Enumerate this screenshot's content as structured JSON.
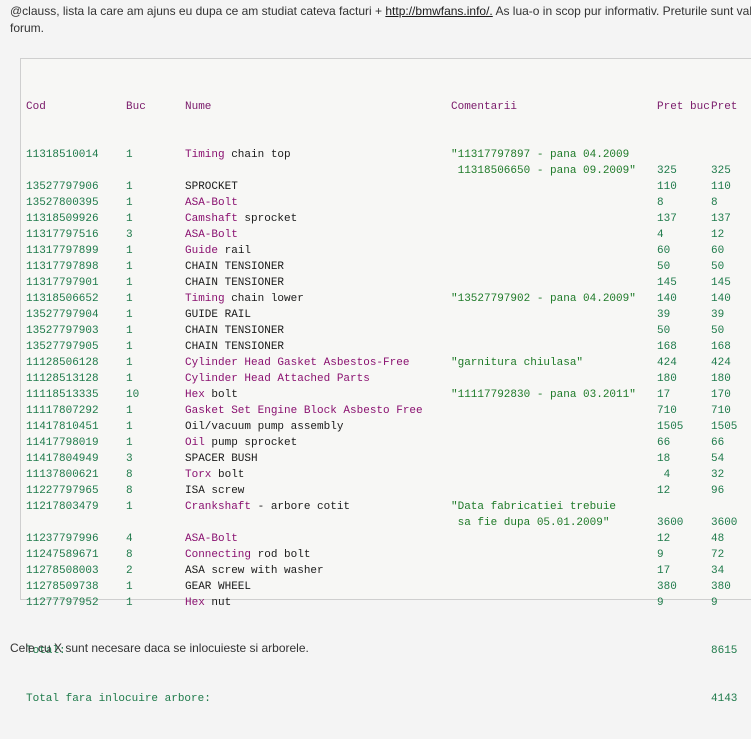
{
  "intro": {
    "text_before": "@clauss, lista la care am ajuns eu dupa ce am studiat cateva facturi + ",
    "link": "http://bmwfans.info/.",
    "text_after": " As lua-o in scop pur informativ. Preturile sunt valab",
    "line2": "forum."
  },
  "table": {
    "headers": {
      "cod": "Cod",
      "buc": "Buc",
      "nume": "Nume",
      "comentarii": "Comentarii",
      "pret_buc": "Pret buc",
      "pret": "Pret"
    },
    "rows": [
      {
        "cod": "11318510014",
        "buc": "1",
        "kw": "Timing",
        "rest": " chain top",
        "com": "\"11317797897 - pana 04.2009",
        "pb": "",
        "pr": ""
      },
      {
        "cod": "",
        "buc": "",
        "kw": "",
        "rest": "",
        "com": " 11318506650 - pana 09.2009\"",
        "pb": "325",
        "pr": "325"
      },
      {
        "cod": "13527797906",
        "buc": "1",
        "kw": "",
        "rest": "SPROCKET",
        "com": "",
        "pb": "110",
        "pr": "110"
      },
      {
        "cod": "13527800395",
        "buc": "1",
        "kw": "ASA-Bolt",
        "rest": "",
        "com": "",
        "pb": "8",
        "pr": "8"
      },
      {
        "cod": "11318509926",
        "buc": "1",
        "kw": "Camshaft",
        "rest": " sprocket",
        "com": "",
        "pb": "137",
        "pr": "137"
      },
      {
        "cod": "11317797516",
        "buc": "3",
        "kw": "ASA-Bolt",
        "rest": "",
        "com": "",
        "pb": "4",
        "pr": "12"
      },
      {
        "cod": "11317797899",
        "buc": "1",
        "kw": "Guide",
        "rest": " rail",
        "com": "",
        "pb": "60",
        "pr": "60"
      },
      {
        "cod": "11317797898",
        "buc": "1",
        "kw": "",
        "rest": "CHAIN TENSIONER",
        "com": "",
        "pb": "50",
        "pr": "50"
      },
      {
        "cod": "11317797901",
        "buc": "1",
        "kw": "",
        "rest": "CHAIN TENSIONER",
        "com": "",
        "pb": "145",
        "pr": "145"
      },
      {
        "cod": "11318506652",
        "buc": "1",
        "kw": "Timing",
        "rest": " chain lower",
        "com": "\"13527797902 - pana 04.2009\"",
        "pb": "140",
        "pr": "140"
      },
      {
        "cod": "13527797904",
        "buc": "1",
        "kw": "",
        "rest": "GUIDE RAIL",
        "com": "",
        "pb": "39",
        "pr": "39"
      },
      {
        "cod": "13527797903",
        "buc": "1",
        "kw": "",
        "rest": "CHAIN TENSIONER",
        "com": "",
        "pb": "50",
        "pr": "50"
      },
      {
        "cod": "13527797905",
        "buc": "1",
        "kw": "",
        "rest": "CHAIN TENSIONER",
        "com": "",
        "pb": "168",
        "pr": "168"
      },
      {
        "cod": "11128506128",
        "buc": "1",
        "kw": "Cylinder Head Gasket Asbestos-Free",
        "rest": "",
        "com": "\"garnitura chiulasa\"",
        "pb": "424",
        "pr": "424"
      },
      {
        "cod": "11128513128",
        "buc": "1",
        "kw": "Cylinder Head Attached Parts",
        "rest": "",
        "com": "",
        "pb": "180",
        "pr": "180"
      },
      {
        "cod": "11118513335",
        "buc": "10",
        "kw": "Hex",
        "rest": " bolt",
        "com": "\"11117792830 - pana 03.2011\"",
        "pb": "17",
        "pr": "170"
      },
      {
        "cod": "11117807292",
        "buc": "1",
        "kw": "Gasket Set Engine Block Asbesto Free",
        "rest": "",
        "com": "",
        "pb": "710",
        "pr": "710"
      },
      {
        "cod": "11417810451",
        "buc": "1",
        "kw": "",
        "rest": "Oil/vacuum pump assembly",
        "com": "",
        "pb": "1505",
        "pr": "1505"
      },
      {
        "cod": "11417798019",
        "buc": "1",
        "kw": "Oil",
        "rest": " pump sprocket",
        "com": "",
        "pb": "66",
        "pr": "66"
      },
      {
        "cod": "11417804949",
        "buc": "3",
        "kw": "",
        "rest": "SPACER BUSH",
        "com": "",
        "pb": "18",
        "pr": "54"
      },
      {
        "cod": "11137800621",
        "buc": "8",
        "kw": "Torx",
        "rest": " bolt",
        "com": "",
        "pb": " 4",
        "pr": "32"
      },
      {
        "cod": "11227797965",
        "buc": "8",
        "kw": "",
        "rest": "ISA screw",
        "com": "",
        "pb": "12",
        "pr": "96"
      },
      {
        "cod": "11217803479",
        "buc": "1",
        "kw": "Crankshaft",
        "rest": " - arbore cotit",
        "com": "\"Data fabricatiei trebuie",
        "pb": "",
        "pr": ""
      },
      {
        "cod": "",
        "buc": "",
        "kw": "",
        "rest": "",
        "com": " sa fie dupa 05.01.2009\"",
        "pb": "3600",
        "pr": "3600"
      },
      {
        "cod": "11237797996",
        "buc": "4",
        "kw": "ASA-Bolt",
        "rest": "",
        "com": "",
        "pb": "12",
        "pr": "48"
      },
      {
        "cod": "11247589671",
        "buc": "8",
        "kw": "Connecting",
        "rest": " rod bolt",
        "com": "",
        "pb": "9",
        "pr": "72"
      },
      {
        "cod": "11278508003",
        "buc": "2",
        "kw": "",
        "rest": "ASA screw with washer",
        "com": "",
        "pb": "17",
        "pr": "34"
      },
      {
        "cod": "11278509738",
        "buc": "1",
        "kw": "",
        "rest": "GEAR WHEEL",
        "com": "",
        "pb": "380",
        "pr": "380"
      },
      {
        "cod": "11277797952",
        "buc": "1",
        "kw": "Hex",
        "rest": " nut",
        "com": "",
        "pb": "9",
        "pr": "9"
      }
    ],
    "total_label": "Total:",
    "total_value": "8615",
    "total2_label": "Total fara inlocuire arbore:",
    "total2_value": "4143"
  },
  "footer": "Cele cu X sunt necesare daca se inlocuieste si arborele."
}
